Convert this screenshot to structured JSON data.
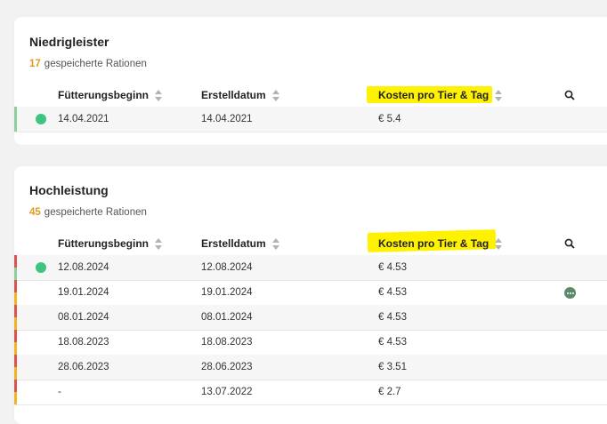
{
  "sections": [
    {
      "title": "Niedrigleister",
      "count": "17",
      "count_suffix": "gespeicherte Rationen",
      "columns": {
        "feeding_start": "Fütterungsbeginn",
        "created": "Erstelldatum",
        "cost": "Kosten pro Tier & Tag"
      },
      "rows": [
        {
          "feeding_start": "14.04.2021",
          "created": "14.04.2021",
          "cost": "€ 5.4",
          "active": true,
          "marker_color": "#8fcf9f"
        }
      ]
    },
    {
      "title": "Hochleistung",
      "count": "45",
      "count_suffix": "gespeicherte Rationen",
      "columns": {
        "feeding_start": "Fütterungsbeginn",
        "created": "Erstelldatum",
        "cost": "Kosten pro Tier & Tag"
      },
      "rows": [
        {
          "feeding_start": "12.08.2024",
          "created": "12.08.2024",
          "cost": "€ 4.53",
          "active": true
        },
        {
          "feeding_start": "19.01.2024",
          "created": "19.01.2024",
          "cost": "€ 4.53",
          "active": false,
          "has_menu": true
        },
        {
          "feeding_start": "08.01.2024",
          "created": "08.01.2024",
          "cost": "€ 4.53",
          "active": false
        },
        {
          "feeding_start": "18.08.2023",
          "created": "18.08.2023",
          "cost": "€ 4.53",
          "active": false
        },
        {
          "feeding_start": "28.06.2023",
          "created": "28.06.2023",
          "cost": "€ 3.51",
          "active": false
        },
        {
          "feeding_start": "-",
          "created": "13.07.2022",
          "cost": "€ 2.7",
          "active": false
        }
      ]
    }
  ],
  "colors": {
    "accent_orange": "#e09a1e",
    "active_dot": "#3fc380",
    "highlight": "#fff200",
    "stripe_red": "#d9534f",
    "stripe_yellow": "#f0b429",
    "menu_green": "#5e8a6b"
  }
}
